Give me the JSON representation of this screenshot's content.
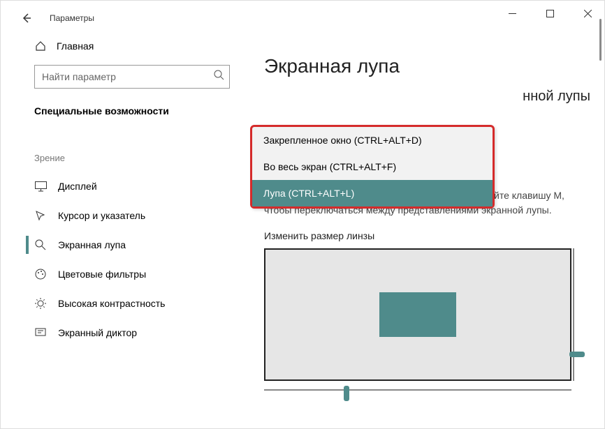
{
  "window": {
    "title": "Параметры"
  },
  "sidebar": {
    "home": "Главная",
    "search_placeholder": "Найти параметр",
    "section": "Специальные возможности",
    "group": "Зрение",
    "items": [
      {
        "label": "Дисплей"
      },
      {
        "label": "Курсор и указатель"
      },
      {
        "label": "Экранная лупа"
      },
      {
        "label": "Цветовые фильтры"
      },
      {
        "label": "Высокая контрастность"
      },
      {
        "label": "Экранный диктор"
      }
    ]
  },
  "main": {
    "title": "Экранная лупа",
    "sub_title_tail": "нной лупы",
    "hint": "Удерживая нажатыми клавиши CTRL+ALT нажимайте клавишу M, чтобы переключаться между представлениями экранной лупы.",
    "lens_label": "Изменить размер линзы"
  },
  "dropdown": {
    "items": [
      "Закрепленное окно (CTRL+ALT+D)",
      "Во весь экран (CTRL+ALT+F)",
      "Лупа (CTRL+ALT+L)"
    ]
  }
}
